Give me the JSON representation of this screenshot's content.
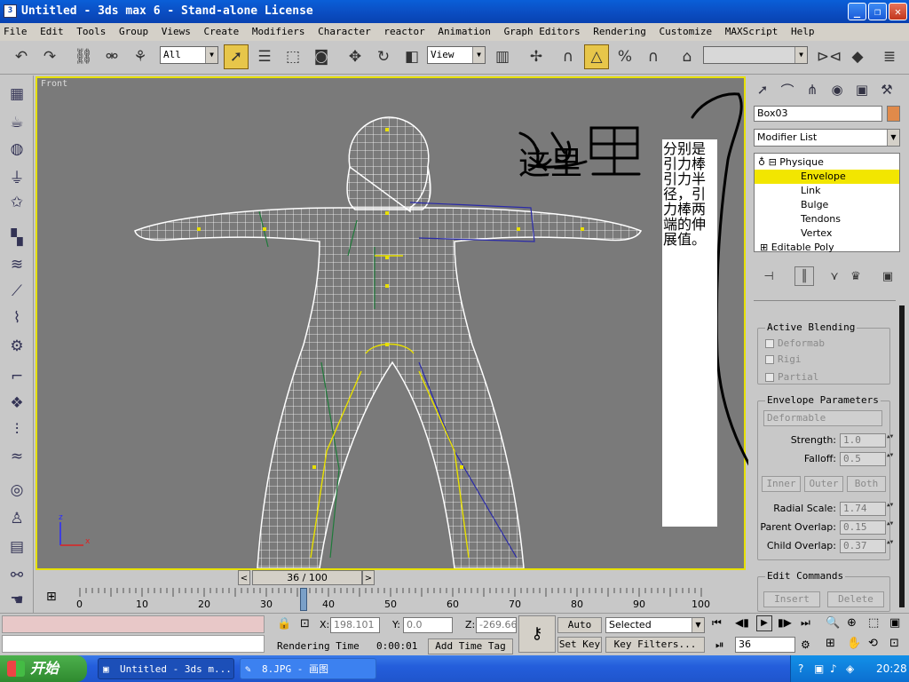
{
  "window": {
    "title": "Untitled  - 3ds max 6  - Stand-alone License",
    "buttons": [
      "_",
      "❐",
      "✕"
    ]
  },
  "menu": [
    "File",
    "Edit",
    "Tools",
    "Group",
    "Views",
    "Create",
    "Modifiers",
    "Character",
    "reactor",
    "Animation",
    "Graph Editors",
    "Rendering",
    "Customize",
    "MAXScript",
    "Help"
  ],
  "toolbar": {
    "selection_filter": "All",
    "ref_coord": "View"
  },
  "viewport": {
    "label": "Front",
    "axis_x": "x",
    "axis_z": "z"
  },
  "annotation": {
    "handwritten": "这里",
    "note": "分别是引力棒引力半径，引力棒两端的伸展值。"
  },
  "command_panel": {
    "object_name": "Box03",
    "object_color": "#e08a4a",
    "modifier_list": "Modifier List",
    "stack": [
      {
        "label": "Physique",
        "level": 0,
        "selected": false
      },
      {
        "label": "Envelope",
        "level": 1,
        "selected": true
      },
      {
        "label": "Link",
        "level": 1,
        "selected": false
      },
      {
        "label": "Bulge",
        "level": 1,
        "selected": false
      },
      {
        "label": "Tendons",
        "level": 1,
        "selected": false
      },
      {
        "label": "Vertex",
        "level": 1,
        "selected": false
      },
      {
        "label": "Editable Poly",
        "level": 0,
        "selected": false
      }
    ],
    "active_blending": {
      "title": "Active Blending",
      "deformable": "Deformab",
      "rigid": "Rigi",
      "partial": "Partial"
    },
    "envelope_params": {
      "title": "Envelope Parameters",
      "type": "Deformable",
      "strength_label": "Strength:",
      "strength": "1.0",
      "falloff_label": "Falloff:",
      "falloff": "0.5",
      "inner": "Inner",
      "outer": "Outer",
      "both": "Both",
      "radial_scale_label": "Radial Scale:",
      "radial_scale": "1.74",
      "parent_overlap_label": "Parent Overlap:",
      "parent_overlap": "0.15",
      "child_overlap_label": "Child Overlap:",
      "child_overlap": "0.37"
    },
    "edit_commands": {
      "title": "Edit Commands",
      "insert": "Insert",
      "delete": "Delete"
    }
  },
  "timeline": {
    "slider": "36 / 100",
    "ticks": [
      "0",
      "10",
      "20",
      "30",
      "40",
      "50",
      "60",
      "70",
      "80",
      "90",
      "100"
    ],
    "current_frame": 36,
    "total_frames": 100
  },
  "status": {
    "x_label": "X:",
    "x": "198.101",
    "y_label": "Y:",
    "y": "0.0",
    "z_label": "Z:",
    "z": "-269.66",
    "rendering_time_label": "Rendering Time",
    "rendering_time": "0:00:01",
    "add_time_tag": "Add Time Tag",
    "auto_key": "Auto Key",
    "set_key": "Set Key",
    "selected": "Selected",
    "key_filters": "Key Filters...",
    "frame_field": "36"
  },
  "taskbar": {
    "start": "开始",
    "tasks": [
      "Untitled  - 3ds m...",
      "8.JPG - 画图"
    ],
    "clock": "20:28"
  }
}
